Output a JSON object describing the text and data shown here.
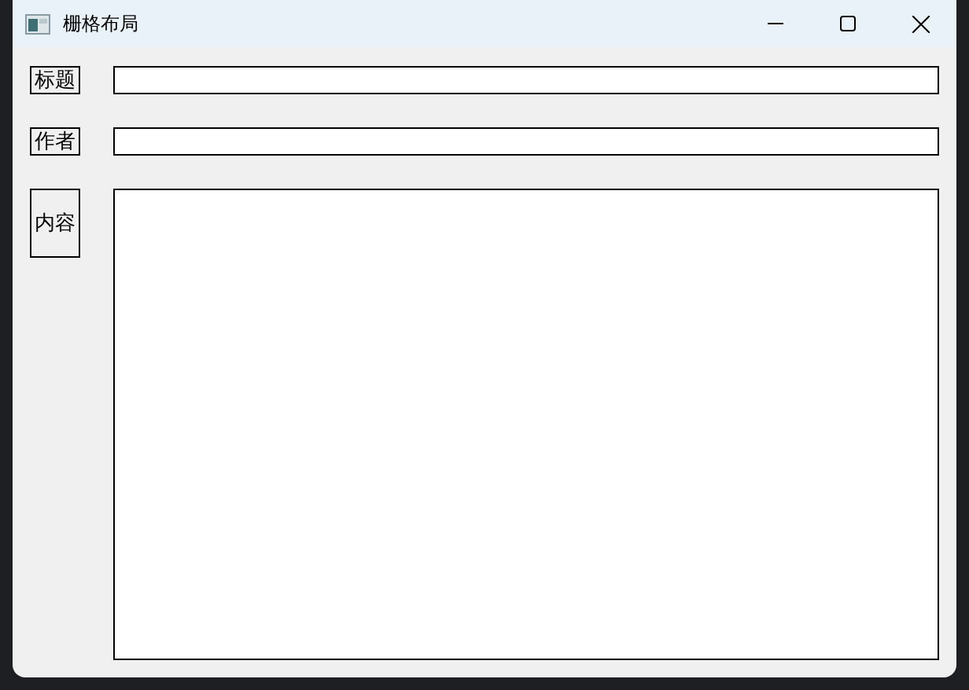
{
  "window": {
    "title": "栅格布局"
  },
  "fields": [
    {
      "label": "标题",
      "kind": "line"
    },
    {
      "label": "作者",
      "kind": "line"
    },
    {
      "label": "内容",
      "kind": "multiline"
    }
  ]
}
